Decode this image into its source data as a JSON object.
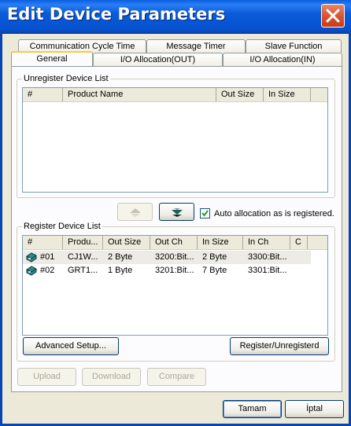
{
  "window": {
    "title": "Edit Device Parameters"
  },
  "tabs": {
    "row_back": [
      "Communication Cycle Time",
      "Message Timer",
      "Slave Function"
    ],
    "row_front": [
      "General",
      "I/O Allocation(OUT)",
      "I/O Allocation(IN)"
    ],
    "active": "General"
  },
  "unregister": {
    "label": "Unregister Device List",
    "columns": [
      "#",
      "Product Name",
      "Out Size",
      "In Size"
    ],
    "rows": []
  },
  "controls": {
    "up_icon": "arrow-up-icon",
    "down_icon": "arrow-down-icon",
    "auto_allocation_label": "Auto allocation as is registered.",
    "auto_allocation_checked": true
  },
  "register": {
    "label": "Register Device List",
    "columns": [
      "#",
      "Produ...",
      "Out Size",
      "Out Ch",
      "In Size",
      "In Ch",
      "C"
    ],
    "rows": [
      {
        "icon": "device-icon",
        "num": "#01",
        "product": "CJ1W...",
        "out_size": "2 Byte",
        "out_ch": "3200:Bit...",
        "in_size": "2 Byte",
        "in_ch": "3300:Bit..."
      },
      {
        "icon": "device-icon",
        "num": "#02",
        "product": "GRT1...",
        "out_size": "1 Byte",
        "out_ch": "3201:Bit...",
        "in_size": "7 Byte",
        "in_ch": "3301:Bit..."
      }
    ],
    "advanced_label": "Advanced Setup...",
    "register_label": "Register/Unregisterd"
  },
  "transfer": {
    "upload": "Upload",
    "download": "Download",
    "compare": "Compare"
  },
  "dialog": {
    "ok": "Tamam",
    "cancel": "İptal"
  }
}
